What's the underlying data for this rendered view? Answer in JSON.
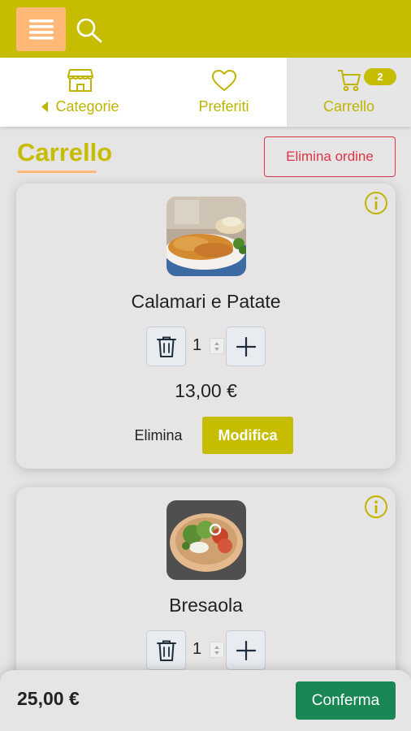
{
  "header": {
    "menu_icon": "hamburger-menu-icon",
    "search_icon": "search-icon",
    "brand_color": "#c7bd00",
    "accent_color": "#ffb877"
  },
  "nav": {
    "categories_label": "Categorie",
    "favorites_label": "Preferiti",
    "cart_label": "Carrello",
    "cart_badge": "2"
  },
  "page": {
    "title": "Carrello",
    "delete_order_label": "Elimina ordine"
  },
  "cart_items": [
    {
      "name": "Calamari e Patate",
      "quantity": "1",
      "price": "13,00 €",
      "delete_label": "Elimina",
      "edit_label": "Modifica"
    },
    {
      "name": "Bresaola",
      "quantity": "1"
    }
  ],
  "footer": {
    "total": "25,00 €",
    "confirm_label": "Conferma",
    "confirm_color": "#198754"
  }
}
